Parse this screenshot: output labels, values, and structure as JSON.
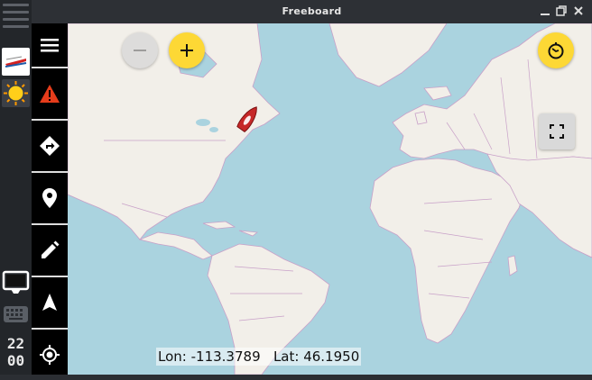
{
  "window": {
    "title": "Freeboard",
    "minimize_icon": "minimize-icon",
    "maximize_icon": "maximize-icon",
    "close_icon": "close-icon"
  },
  "dock": {
    "clock_hour": "22",
    "clock_minute": "00",
    "apps": [
      "boat-app-icon",
      "weather-app-icon",
      "terminal-icon",
      "keyboard-icon"
    ]
  },
  "toolbar": {
    "items": [
      "menu-icon",
      "alert-icon",
      "route-icon",
      "waypoint-icon",
      "edit-icon",
      "navigation-icon",
      "locate-icon"
    ]
  },
  "map": {
    "coordinates": {
      "lon_label": "Lon:",
      "lon_value": "-113.3789",
      "lat_label": "Lat:",
      "lat_value": "46.1950"
    },
    "zoom_out_icon": "minus-icon",
    "zoom_in_icon": "plus-icon",
    "timer_icon": "timer-icon",
    "fullscreen_icon": "fullscreen-icon",
    "colors": {
      "water": "#aad3df",
      "land": "#f2efe9",
      "border": "#c8a0c8",
      "accent": "#fdd835"
    }
  }
}
